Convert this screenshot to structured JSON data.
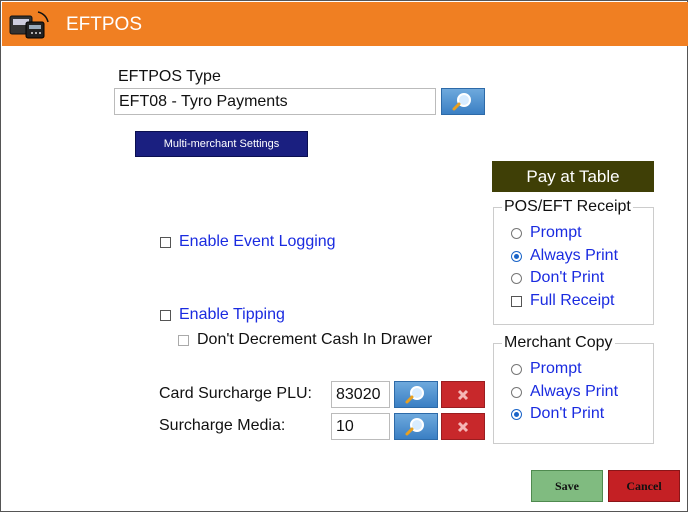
{
  "window": {
    "title": "EFTPOS",
    "app_icon": "eftpos-terminal-icon"
  },
  "eftpos_type": {
    "label": "EFTPOS Type",
    "value": "EFT08 - Tyro Payments",
    "search_icon": "magnifier-icon"
  },
  "multi_merchant": {
    "label": "Multi-merchant Settings"
  },
  "pay_at_table": {
    "label": "Pay at Table"
  },
  "options": {
    "event_logging": {
      "label": "Enable Event Logging",
      "checked": false
    },
    "tipping": {
      "label": "Enable Tipping",
      "checked": false
    },
    "dont_decrement": {
      "label": "Don't Decrement Cash In Drawer",
      "checked": false,
      "enabled": false
    }
  },
  "surcharge": {
    "plu_label": "Card Surcharge PLU:",
    "plu_value": "83020",
    "media_label": "Surcharge Media:",
    "media_value": "10"
  },
  "receipt": {
    "title": "POS/EFT Receipt",
    "options": [
      {
        "label": "Prompt",
        "selected": false
      },
      {
        "label": "Always Print",
        "selected": true
      },
      {
        "label": "Don't Print",
        "selected": false
      }
    ],
    "full_receipt": {
      "label": "Full Receipt",
      "checked": false
    }
  },
  "merchant_copy": {
    "title": "Merchant Copy",
    "options": [
      {
        "label": "Prompt",
        "selected": false
      },
      {
        "label": "Always Print",
        "selected": false
      },
      {
        "label": "Don't Print",
        "selected": true
      }
    ]
  },
  "footer": {
    "save_label": "Save",
    "cancel_label": "Cancel"
  },
  "colors": {
    "title_bar": "#f07f22",
    "pay_at_table": "#3f3f06",
    "multi_merchant": "#1a1f80",
    "save": "#80bb80",
    "cancel": "#c42024",
    "option_text": "#1a2be0"
  }
}
